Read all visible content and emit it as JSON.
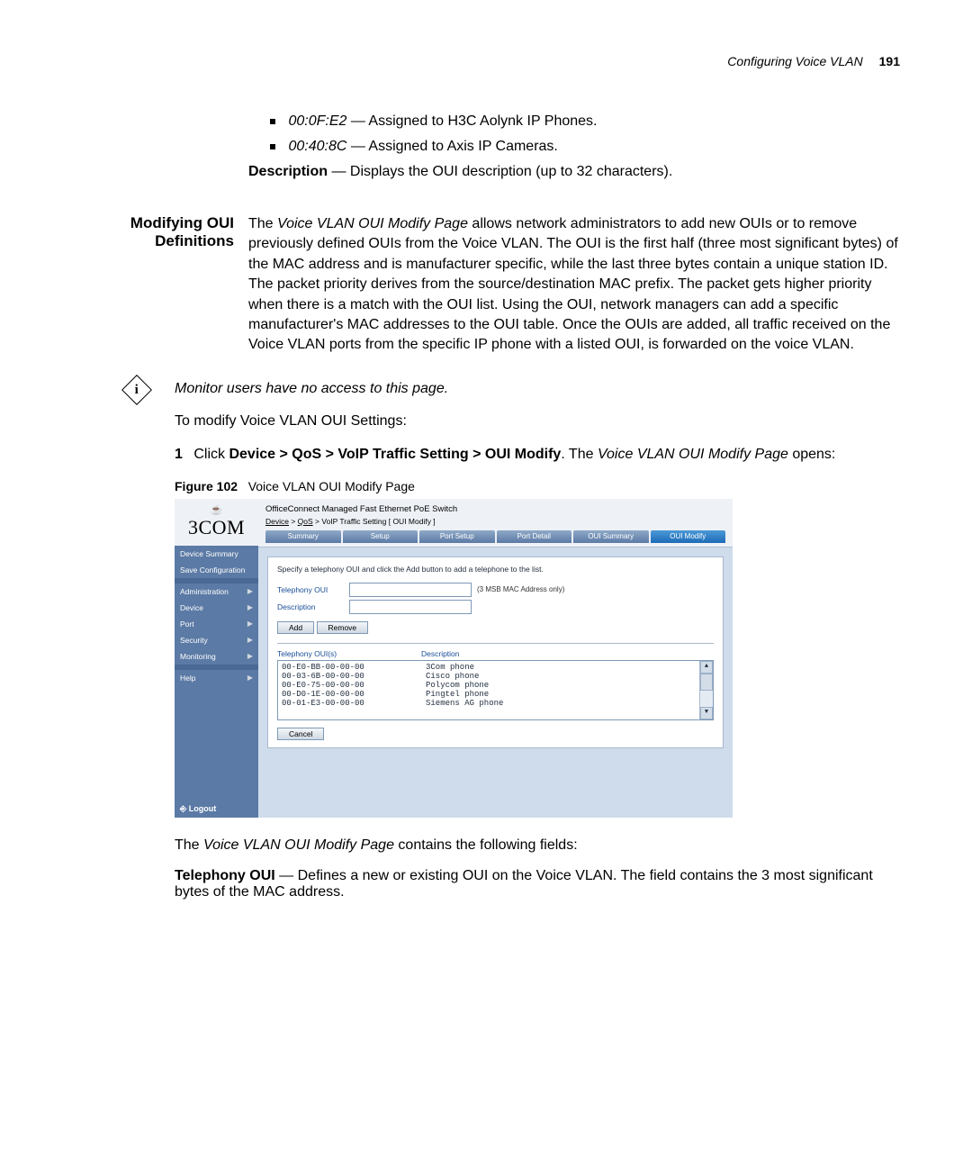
{
  "header": {
    "title": "Configuring Voice VLAN",
    "page": "191"
  },
  "bullets_top": [
    {
      "code": "00:0F:E2",
      "text": "— Assigned to H3C Aolynk IP Phones."
    },
    {
      "code": "00:40:8C",
      "text": "— Assigned to Axis IP Cameras."
    }
  ],
  "desc_bullet": {
    "bold": "Description",
    "text": " — Displays the OUI description (up to 32 characters)."
  },
  "section_heading": "Modifying OUI Definitions",
  "section_para": "The Voice VLAN OUI Modify Page allows network administrators to add new OUIs or to remove previously defined OUIs from the Voice VLAN. The OUI is the first half (three most significant bytes) of the MAC address and is manufacturer specific, while the last three bytes contain a unique station ID. The packet priority derives from the source/destination MAC prefix. The packet gets higher priority when there is a match with the OUI list. Using the OUI, network managers can add a specific manufacturer's MAC addresses to the OUI table. Once the OUIs are added, all traffic received on the Voice VLAN ports from the specific IP phone with a listed OUI, is forwarded on the voice VLAN.",
  "info_note": "Monitor users have no access to this page.",
  "para2": "To modify Voice VLAN OUI Settings:",
  "step1": {
    "num": "1",
    "pre": "Click ",
    "bold": "Device > QoS > VoIP Traffic Setting > OUI Modify",
    "mid": ". The ",
    "em": "Voice VLAN OUI Modify Page",
    "post": " opens:"
  },
  "figure": {
    "num": "Figure 102",
    "caption": "Voice VLAN OUI Modify Page"
  },
  "screenshot": {
    "logo": "3COM",
    "product": "OfficeConnect Managed Fast Ethernet PoE Switch",
    "crumb_a": "Device",
    "crumb_b": "QoS",
    "crumb_c": "VoIP Traffic Setting [ OUI Modify ]",
    "tabs": [
      "Summary",
      "Setup",
      "Port Setup",
      "Port Detail",
      "OUI Summary",
      "OUI Modify"
    ],
    "sidebar": {
      "section1": [
        "Device Summary",
        "Save Configuration"
      ],
      "section2": [
        "Administration",
        "Device",
        "Port",
        "Security",
        "Monitoring"
      ],
      "section3": [
        "Help"
      ],
      "logout": "Logout"
    },
    "instruction": "Specify a telephony OUI and click the Add button to add a telephone to the list.",
    "form": {
      "telephony_lbl": "Telephony OUI",
      "telephony_note": "(3 MSB MAC Address only)",
      "description_lbl": "Description",
      "add_btn": "Add",
      "remove_btn": "Remove",
      "cancel_btn": "Cancel"
    },
    "cols": {
      "oui": "Telephony OUI(s)",
      "desc": "Description"
    },
    "rows": [
      {
        "oui": "00-E0-BB-00-00-00",
        "desc": "3Com phone"
      },
      {
        "oui": "00-03-6B-00-00-00",
        "desc": "Cisco phone"
      },
      {
        "oui": "00-E0-75-00-00-00",
        "desc": "Polycom phone"
      },
      {
        "oui": "00-D0-1E-00-00-00",
        "desc": "Pingtel phone"
      },
      {
        "oui": "00-01-E3-00-00-00",
        "desc": "Siemens AG phone"
      }
    ]
  },
  "para_after_fig": {
    "pre": "The ",
    "em": "Voice VLAN OUI Modify Page",
    "post": " contains the following fields:"
  },
  "field_bullet": {
    "bold": "Telephony OUI",
    "text": " — Defines a new or existing OUI on the Voice VLAN. The field contains the 3 most significant bytes of the MAC address."
  }
}
